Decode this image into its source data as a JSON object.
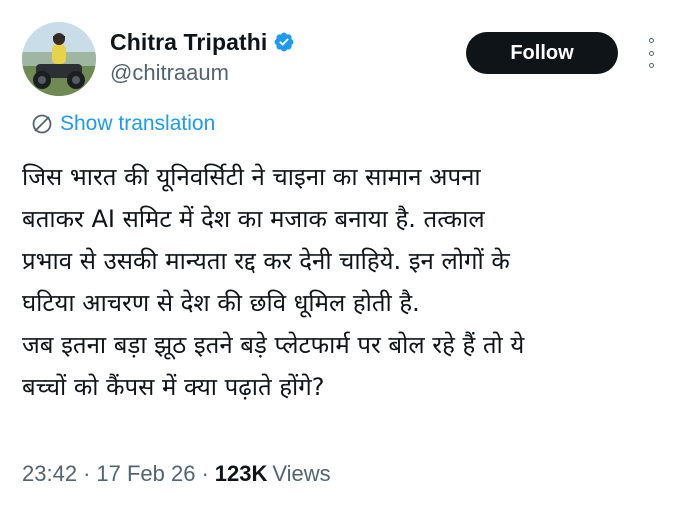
{
  "author": {
    "display_name": "Chitra Tripathi",
    "handle": "@chitraaum",
    "verified": true,
    "verified_color": "#1d9bf0"
  },
  "actions": {
    "follow_label": "Follow",
    "more_icon": "more-vertical-icon"
  },
  "translation": {
    "icon": "globe-icon",
    "label": "Show translation",
    "color": "#1d9bf0"
  },
  "tweet": {
    "text": "जिस भारत की यूनिवर्सिटी ने चाइना का सामान अपना\nबताकर AI समिट में देश का मजाक बनाया है. तत्काल\nप्रभाव से उसकी मान्यता रद्द कर देनी चाहिये. इन लोगों के\nघटिया आचरण से देश की छवि धूमिल होती है.\nजब इतना बड़ा झूठ इतने बड़े प्लेटफार्म पर बोल रहे हैं तो ये\nबच्चों को कैंपस में क्या पढ़ाते होंगे?"
  },
  "meta": {
    "time": "23:42",
    "separator": "·",
    "date": "17 Feb 26",
    "views_count": "123K",
    "views_label": "Views"
  }
}
